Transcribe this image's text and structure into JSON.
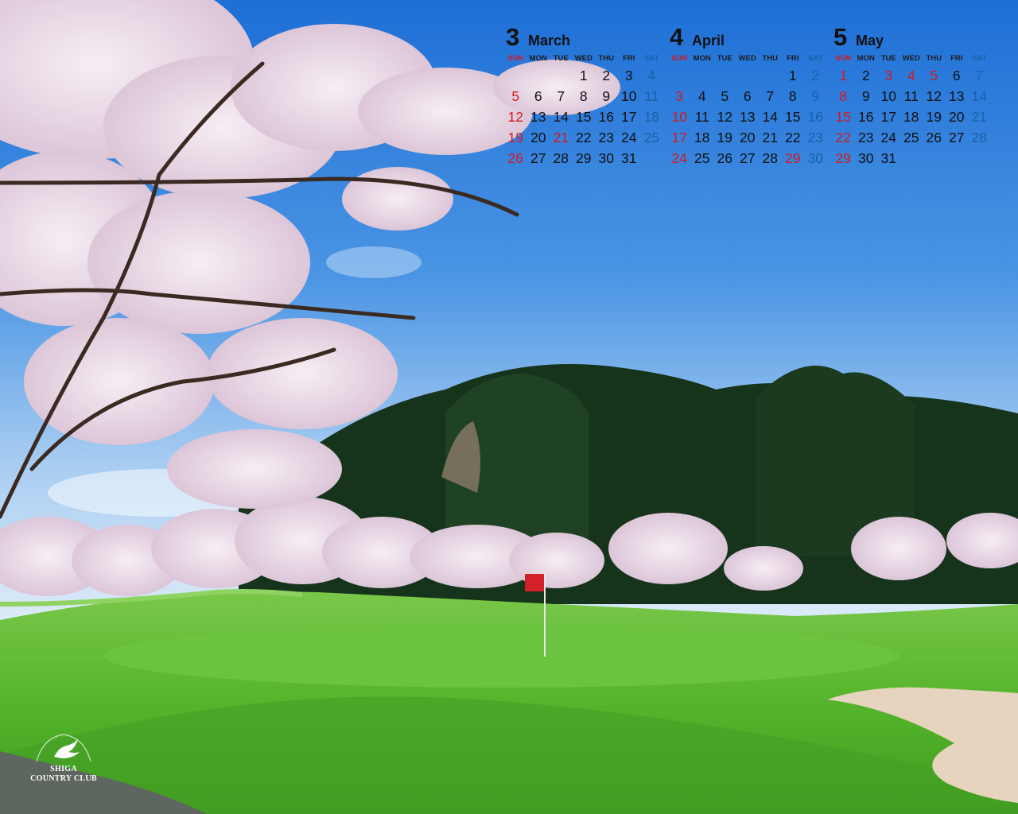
{
  "calendar": {
    "dow": [
      "SUN",
      "MON",
      "TUE",
      "WED",
      "THU",
      "FRI",
      "SAT"
    ],
    "months": [
      {
        "num": "3",
        "name": "March",
        "lead": 3,
        "days": 31,
        "holidays": [
          21
        ]
      },
      {
        "num": "4",
        "name": "April",
        "lead": 5,
        "days": 30,
        "holidays": [
          29
        ]
      },
      {
        "num": "5",
        "name": "May",
        "lead": 0,
        "days": 31,
        "holidays": [
          3,
          4,
          5
        ]
      }
    ]
  },
  "logo": {
    "line1": "SHIGA",
    "line2": "COUNTRY CLUB",
    "arc_text": "SHIGA COUNTRY CLUB"
  },
  "colors": {
    "sunday": "#d21a21",
    "saturday": "#1a61a8",
    "sky": "#2a7ad8",
    "grass": "#4eb028"
  }
}
